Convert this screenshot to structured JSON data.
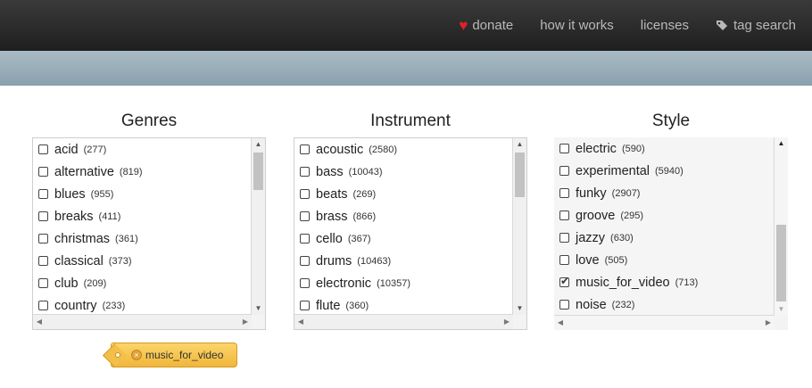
{
  "nav": {
    "donate": "donate",
    "how_it_works": "how it works",
    "licenses": "licenses",
    "tag_search": "tag search"
  },
  "columns": {
    "genres": {
      "title": "Genres",
      "items": [
        {
          "label": "acid",
          "count": "(277)"
        },
        {
          "label": "alternative",
          "count": "(819)"
        },
        {
          "label": "blues",
          "count": "(955)"
        },
        {
          "label": "breaks",
          "count": "(411)"
        },
        {
          "label": "christmas",
          "count": "(361)"
        },
        {
          "label": "classical",
          "count": "(373)"
        },
        {
          "label": "club",
          "count": "(209)"
        },
        {
          "label": "country",
          "count": "(233)"
        }
      ]
    },
    "instrument": {
      "title": "Instrument",
      "items": [
        {
          "label": "acoustic",
          "count": "(2580)"
        },
        {
          "label": "bass",
          "count": "(10043)"
        },
        {
          "label": "beats",
          "count": "(269)"
        },
        {
          "label": "brass",
          "count": "(866)"
        },
        {
          "label": "cello",
          "count": "(367)"
        },
        {
          "label": "drums",
          "count": "(10463)"
        },
        {
          "label": "electronic",
          "count": "(10357)"
        },
        {
          "label": "flute",
          "count": "(360)"
        }
      ]
    },
    "style": {
      "title": "Style",
      "items": [
        {
          "label": "electric",
          "count": "(590)",
          "checked": false
        },
        {
          "label": "experimental",
          "count": "(5940)",
          "checked": false
        },
        {
          "label": "funky",
          "count": "(2907)",
          "checked": false
        },
        {
          "label": "groove",
          "count": "(295)",
          "checked": false
        },
        {
          "label": "jazzy",
          "count": "(630)",
          "checked": false
        },
        {
          "label": "love",
          "count": "(505)",
          "checked": false
        },
        {
          "label": "music_for_video",
          "count": "(713)",
          "checked": true
        },
        {
          "label": "noise",
          "count": "(232)",
          "checked": false
        }
      ]
    }
  },
  "selected_tag": {
    "label": "music_for_video"
  },
  "colors": {
    "topbar": "#2a2a2a",
    "band": "#9aaebb",
    "heart": "#e0202a",
    "chip": "#f5c24e"
  }
}
